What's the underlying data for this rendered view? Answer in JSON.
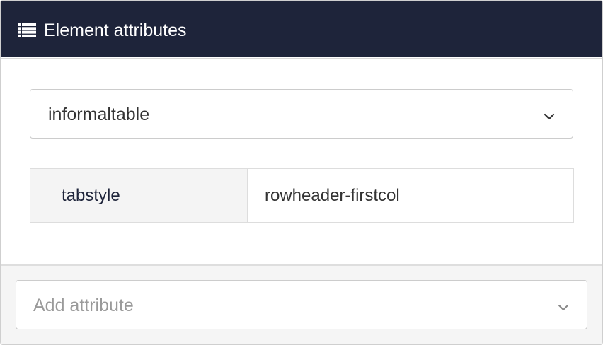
{
  "panel": {
    "title": "Element attributes",
    "header_icon": "list-icon"
  },
  "element_select": {
    "value": "informaltable",
    "icon": "chevron-down-icon"
  },
  "attributes": [
    {
      "name": "tabstyle",
      "value": "rowheader-firstcol"
    }
  ],
  "add_attribute": {
    "placeholder": "Add attribute",
    "icon": "chevron-down-icon"
  },
  "colors": {
    "header_bg": "#1e243a",
    "header_text": "#ffffff",
    "attr_name_text": "#1e243a",
    "placeholder_text": "#9a9a9a",
    "footer_bg": "#f5f5f5"
  }
}
